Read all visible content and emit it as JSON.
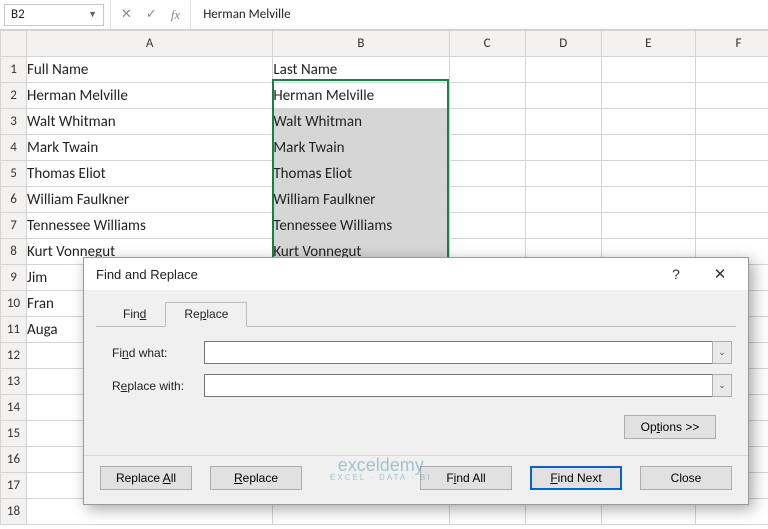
{
  "namebox": {
    "value": "B2"
  },
  "formula_bar": {
    "value": "Herman Melville"
  },
  "columns": [
    "A",
    "B",
    "C",
    "D",
    "E",
    "F"
  ],
  "row_numbers": [
    "1",
    "2",
    "3",
    "4",
    "5",
    "6",
    "7",
    "8",
    "9",
    "10",
    "11",
    "12",
    "13",
    "14",
    "15",
    "16",
    "17",
    "18"
  ],
  "headers": {
    "A": "Full Name",
    "B": "Last Name"
  },
  "col_a": [
    "Herman Melville",
    "Walt Whitman",
    "Mark Twain",
    "Thomas Eliot",
    "William Faulkner",
    "Tennessee Williams",
    "Kurt Vonnegut",
    "Jim",
    "Fran",
    "Auga"
  ],
  "col_b": [
    "Herman Melville",
    "Walt Whitman",
    "Mark Twain",
    "Thomas Eliot",
    "William Faulkner",
    "Tennessee Williams",
    "Kurt Vonnegut"
  ],
  "dialog": {
    "title": "Find and Replace",
    "tabs": {
      "find": "Find",
      "replace": "Replace"
    },
    "find_label": "Find what:",
    "replace_label": "Replace with:",
    "find_value": "",
    "replace_value": "",
    "options": "Options >>",
    "buttons": {
      "replace_all": "Replace All",
      "replace": "Replace",
      "find_all": "Find All",
      "find_next": "Find Next",
      "close": "Close"
    }
  },
  "watermark": {
    "main": "exceldemy",
    "sub": "EXCEL · DATA · BI"
  }
}
